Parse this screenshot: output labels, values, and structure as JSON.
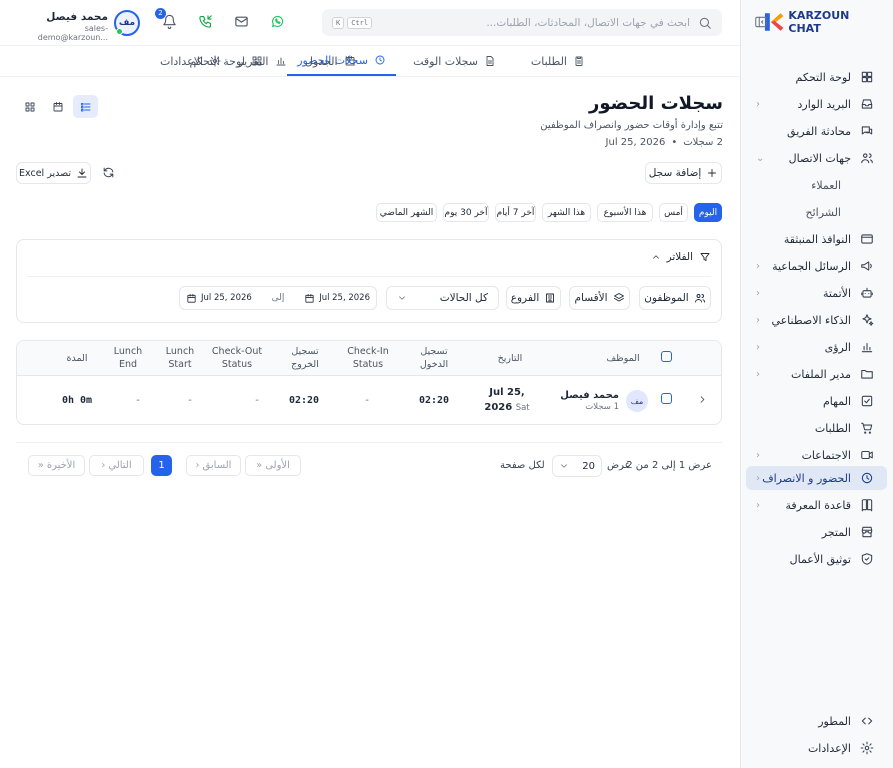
{
  "brand": {
    "name": "KARZOUN CHAT"
  },
  "sidebar": {
    "items": [
      {
        "label": "لوحة التحكم",
        "icon": "dashboard-icon"
      },
      {
        "label": "البريد الوارد",
        "icon": "inbox-icon"
      },
      {
        "label": "محادثة الفريق",
        "icon": "chat-icon"
      },
      {
        "label": "جهات الاتصال",
        "icon": "users-icon"
      },
      {
        "label": "العملاء"
      },
      {
        "label": "الشرائح"
      },
      {
        "label": "النوافذ المنبثقة",
        "icon": "popup-icon"
      },
      {
        "label": "الرسائل الجماعية",
        "icon": "megaphone-icon"
      },
      {
        "label": "الأتمتة",
        "icon": "bot-icon"
      },
      {
        "label": "الذكاء الاصطناعي",
        "icon": "sparkles-icon"
      },
      {
        "label": "الرؤى",
        "icon": "bar-chart-icon"
      },
      {
        "label": "مدير الملفات",
        "icon": "folder-icon"
      },
      {
        "label": "المهام",
        "icon": "checkbox-icon"
      },
      {
        "label": "الطلبات",
        "icon": "cart-icon"
      },
      {
        "label": "الاجتماعات",
        "icon": "video-icon"
      },
      {
        "label": "الحضور و الانصراف",
        "icon": "clock-icon"
      },
      {
        "label": "قاعدة المعرفة",
        "icon": "book-icon"
      },
      {
        "label": "المتجر",
        "icon": "store-icon"
      },
      {
        "label": "توثيق الأعمال",
        "icon": "shield-check-icon"
      }
    ],
    "bottom": [
      {
        "label": "المطور",
        "icon": "code-icon"
      },
      {
        "label": "الإعدادات",
        "icon": "gear-icon"
      }
    ]
  },
  "header": {
    "search_placeholder": "ابحث في جهات الاتصال، المحادثات، الطلبات...",
    "kbd_ctrl": "Ctrl",
    "kbd_k": "K",
    "notifications_count": "2",
    "user_name": "محمد فيصل",
    "user_email": "sales-demo@karzoun...",
    "avatar_initials": "مف"
  },
  "tabs": [
    {
      "label": "لوحة التحكم",
      "icon": "grid-icon"
    },
    {
      "label": "سجلات الحضور",
      "icon": "clock-icon"
    },
    {
      "label": "سجلات الوقت",
      "icon": "file-icon"
    },
    {
      "label": "الطلبات",
      "icon": "clipboard-icon"
    },
    {
      "label": "الجدول",
      "icon": "calendar-icon"
    },
    {
      "label": "التقرير",
      "icon": "bar-chart-icon"
    },
    {
      "label": "الإعدادات",
      "icon": "gear-icon"
    }
  ],
  "page": {
    "title": "سجلات الحضور",
    "subtitle": "تتبع وإدارة أوقات حضور وانصراف الموظفين",
    "count": "2 سجلات",
    "date": "Jul 25, 2026",
    "add_button": "إضافة سجل",
    "export_button": "تصدير Excel"
  },
  "quick_filters": [
    "اليوم",
    "أمس",
    "هذا الأسبوع",
    "هذا الشهر",
    "آخر 7 أيام",
    "آخر 30 يوم",
    "الشهر الماضي"
  ],
  "filters": {
    "title": "الفلاتر",
    "employees": "الموظفون",
    "departments": "الأقسام",
    "branches": "الفروع",
    "status": "كل الحالات",
    "date_from": "Jul 25, 2026",
    "to_label": "إلى",
    "date_to": "Jul 25, 2026"
  },
  "table": {
    "headers": {
      "employee": "الموظف",
      "date": "التاريخ",
      "checkin": "تسجيل الدخول",
      "checkin_status": "Check-In Status",
      "checkout": "تسجيل الخروج",
      "checkout_status": "Check-Out Status",
      "lunch_start": "Lunch Start",
      "lunch_end": "Lunch End",
      "duration": "المدة"
    },
    "rows": [
      {
        "initials": "مف",
        "name": "محمد فيصل",
        "records": "1 سجلات",
        "date": "Jul 25,",
        "date_year": "2026",
        "date_day": "Sat",
        "checkin": "02:20",
        "checkin_status": "-",
        "checkout": "02:20",
        "checkout_status": "-",
        "lunch_start": "-",
        "lunch_end": "-",
        "duration": "0h 0m"
      }
    ]
  },
  "pagination": {
    "summary": "عرض 1 إلى 2 من 2",
    "show": "عرض",
    "per_page": "20",
    "per_page_suffix": "لكل صفحة",
    "first": "الأولى",
    "prev": "السابق",
    "current": "1",
    "next": "التالي",
    "last": "الأخيرة"
  },
  "colors": {
    "accent": "#2563eb",
    "active_bg": "#e0e7f5",
    "whatsapp": "#22c55e"
  }
}
